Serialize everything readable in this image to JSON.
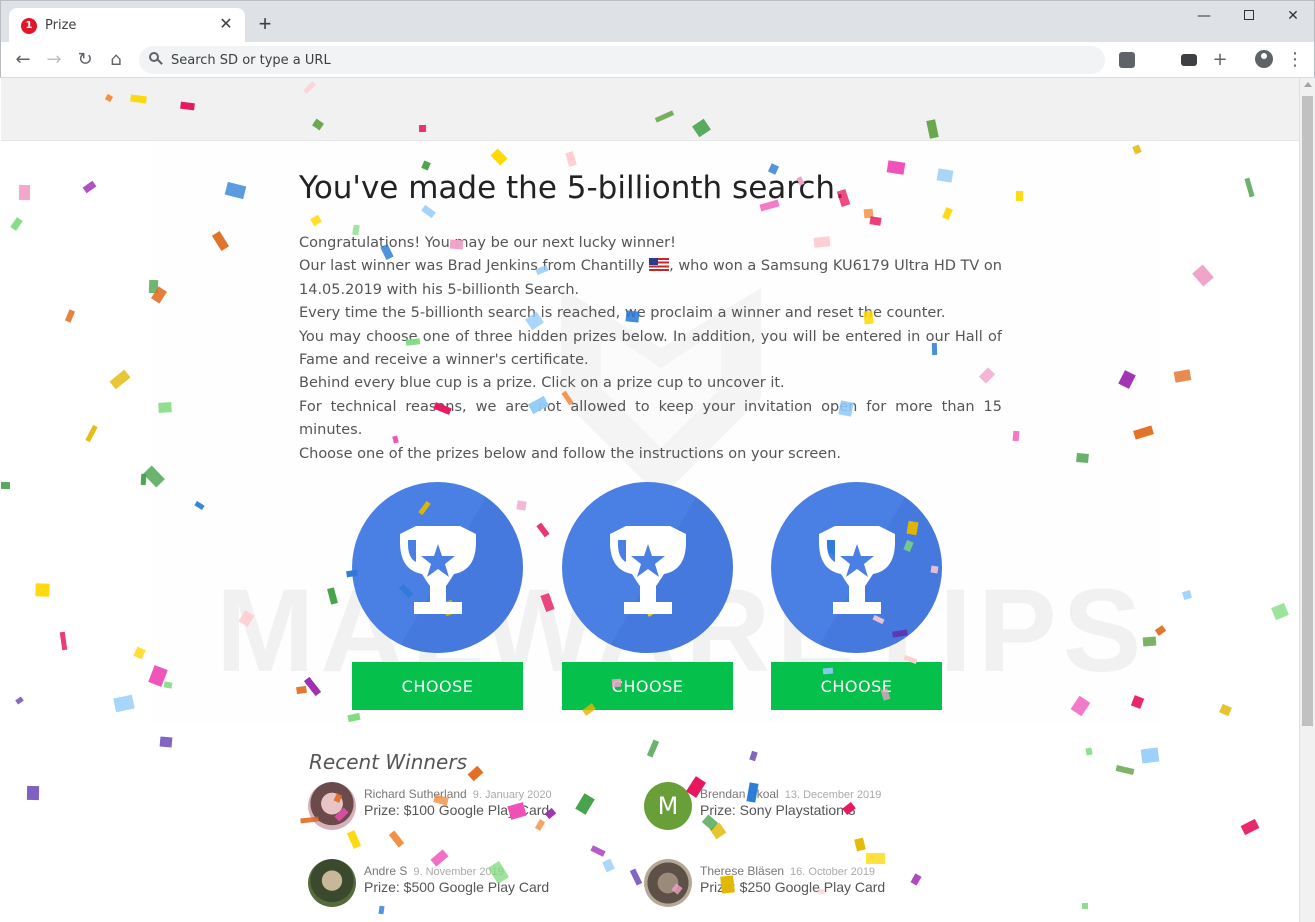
{
  "browser": {
    "tab_title": "Prize",
    "tab_badge": "1",
    "new_tab": "+",
    "close_tab": "✕",
    "omnibox_placeholder": "Search SD or type a URL",
    "back": "←",
    "forward": "→",
    "reload": "↻",
    "home": "⌂",
    "minimize": "—",
    "close_window": "✕",
    "add": "+",
    "menu": "⋮",
    "icons": [
      "back-arrow-icon",
      "forward-arrow-icon",
      "reload-icon",
      "home-icon",
      "search-icon",
      "music-extension-icon",
      "radio-extension-icon",
      "plus-icon",
      "profile-icon",
      "kebab-menu-icon"
    ]
  },
  "page": {
    "headline": "You've made the 5-billionth search.",
    "paragraphs": {
      "p1": "Congratulations! You may be our next lucky winner!",
      "p2a": "Our last winner was Brad Jenkins from Chantilly ",
      "p2b": ", who won a Samsung KU6179 Ultra HD TV on 14.05.2019 with his 5-billionth Search.",
      "p3": "Every time the 5-billionth search is reached, we proclaim a winner and reset the counter.",
      "p4": "You may choose one of three hidden prizes below. In addition, you will be entered in our Hall of Fame and receive a winner's certificate.",
      "p5": "Behind every blue cup is a prize. Click on a prize cup to uncover it.",
      "p6": "For technical reasons, we are not allowed to keep your invitation open for more than 15 minutes.",
      "p7": "Choose one of the prizes below and follow the instructions on your screen."
    },
    "prizes": [
      {
        "button": "CHOOSE"
      },
      {
        "button": "CHOOSE"
      },
      {
        "button": "CHOOSE"
      }
    ],
    "watermark": "MALWARETIPS",
    "recent_winners_title": "Recent Winners",
    "winners": [
      {
        "name": "Richard Sutherland",
        "date": "9. January 2020",
        "prize": "Prize: $100 Google Play Card"
      },
      {
        "name": "Brendan Skoal",
        "date": "13. December 2019",
        "prize": "Prize: Sony Playstation 3",
        "initial": "M"
      },
      {
        "name": "Andre S",
        "date": "9. November 2019",
        "prize": "Prize: $500 Google Play Card"
      },
      {
        "name": "Therese Bläsen",
        "date": "16. October 2019",
        "prize": "Prize: $250 Google Play Card"
      }
    ]
  },
  "colors": {
    "cup_blue": "#4a7fe3",
    "button_green": "#05c04b",
    "confetti": [
      "#2a7bd6",
      "#e2b700",
      "#ffd700",
      "#e8175d",
      "#f1a2c8",
      "#6aa84f",
      "#43a047",
      "#e06b1f",
      "#f28b3b",
      "#9c27b0",
      "#ef4fb8",
      "#90caf9",
      "#7fdb7f",
      "#5e35b1",
      "#ffcdd2"
    ]
  }
}
